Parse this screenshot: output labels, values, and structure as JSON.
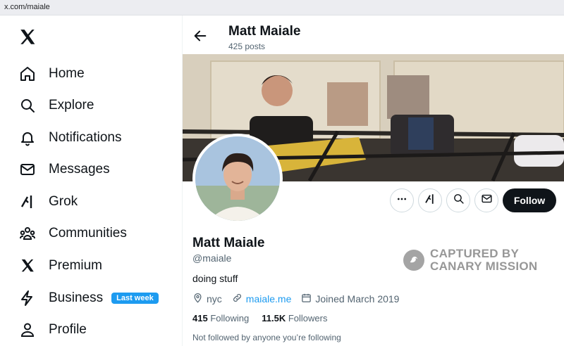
{
  "browser": {
    "url": "x.com/maiale"
  },
  "nav": {
    "items": [
      {
        "label": "Home",
        "icon": "home-icon"
      },
      {
        "label": "Explore",
        "icon": "search-icon"
      },
      {
        "label": "Notifications",
        "icon": "bell-icon"
      },
      {
        "label": "Messages",
        "icon": "envelope-icon"
      },
      {
        "label": "Grok",
        "icon": "grok-icon"
      },
      {
        "label": "Communities",
        "icon": "people-icon"
      },
      {
        "label": "Premium",
        "icon": "x-logo-icon"
      },
      {
        "label": "Business",
        "icon": "lightning-icon",
        "badge": "Last week"
      },
      {
        "label": "Profile",
        "icon": "person-icon"
      }
    ]
  },
  "header": {
    "name": "Matt Maiale",
    "posts": "425 posts"
  },
  "profile": {
    "name": "Matt Maiale",
    "handle": "@maiale",
    "bio": "doing stuff",
    "location": "nyc",
    "website": "maiale.me",
    "joined": "Joined March 2019",
    "following_count": "415",
    "following_label": "Following",
    "followers_count": "11.5K",
    "followers_label": "Followers",
    "followed_by": "Not followed by anyone you’re following"
  },
  "actions": {
    "follow_label": "Follow"
  },
  "watermark": {
    "line1": "CAPTURED BY",
    "line2": "CANARY MISSION"
  },
  "colors": {
    "accent": "#1d9bf0",
    "text": "#0f1419",
    "muted": "#536471",
    "follow_bg": "#0f1419"
  }
}
